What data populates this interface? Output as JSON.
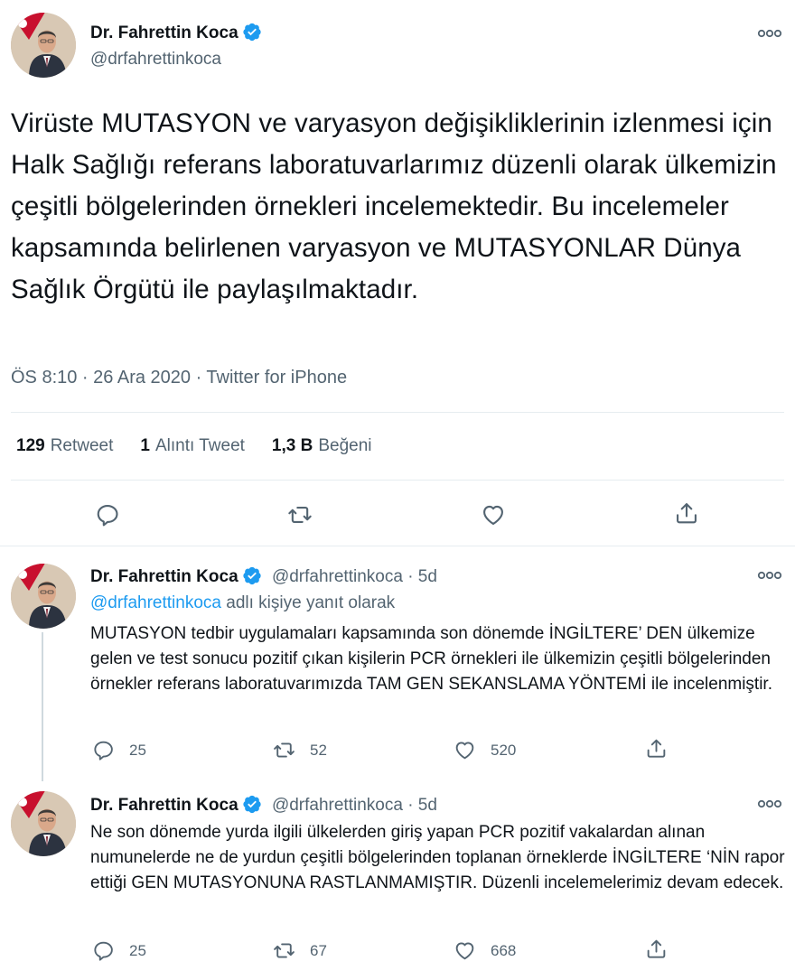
{
  "main_tweet": {
    "author_name": "Dr. Fahrettin Koca",
    "author_handle": "@drfahrettinkoca",
    "text": "Virüste MUTASYON ve varyasyon değişikliklerinin izlenmesi için Halk Sağlığı referans laboratuvarlarımız düzenli olarak ülkemizin çeşitli bölgelerinden örnekleri incelemektedir. Bu incelemeler kapsamında belirlenen varyasyon ve MUTASYONLAR Dünya Sağlık Örgütü ile paylaşılmaktadır.",
    "meta": "ÖS 8:10 · 26 Ara 2020 · Twitter for iPhone",
    "retweets_count": "129",
    "retweets_label": "Retweet",
    "quotes_count": "1",
    "quotes_label": "Alıntı Tweet",
    "likes_count": "1,3 B",
    "likes_label": "Beğeni"
  },
  "replies": [
    {
      "author_name": "Dr. Fahrettin Koca",
      "author_handle": "@drfahrettinkoca",
      "time": "· 5d",
      "reply_to_mention": "@drfahrettinkoca",
      "reply_to_suffix": "adlı kişiye yanıt olarak",
      "text": "MUTASYON tedbir uygulamaları kapsamında son dönemde İNGİLTERE’ DEN ülkemize gelen ve test sonucu pozitif çıkan kişilerin PCR örnekleri ile ülkemizin çeşitli bölgelerinden örnekler referans laboratuvarımızda TAM GEN SEKANSLAMA YÖNTEMİ ile incelenmiştir.",
      "replies_count": "25",
      "retweets_count": "52",
      "likes_count": "520"
    },
    {
      "author_name": "Dr. Fahrettin Koca",
      "author_handle": "@drfahrettinkoca",
      "time": "· 5d",
      "text": "Ne son dönemde yurda ilgili ülkelerden giriş yapan PCR pozitif vakalardan alınan numunelerde ne de yurdun çeşitli bölgelerinden toplanan örneklerde İNGİLTERE ‘NİN rapor ettiği GEN MUTASYONUNA  RASTLANMAMIŞTIR. Düzenli incelemelerimiz devam edecek.",
      "replies_count": "25",
      "retweets_count": "67",
      "likes_count": "668"
    }
  ],
  "icons": {
    "verified": "verified-badge-icon",
    "more": "more-options-icon",
    "reply": "reply-icon",
    "retweet": "retweet-icon",
    "like": "like-icon",
    "share": "share-icon"
  },
  "colors": {
    "accent": "#1d9bf0",
    "text": "#0f1419",
    "secondary": "#536471",
    "divider": "#e6ecf0"
  }
}
